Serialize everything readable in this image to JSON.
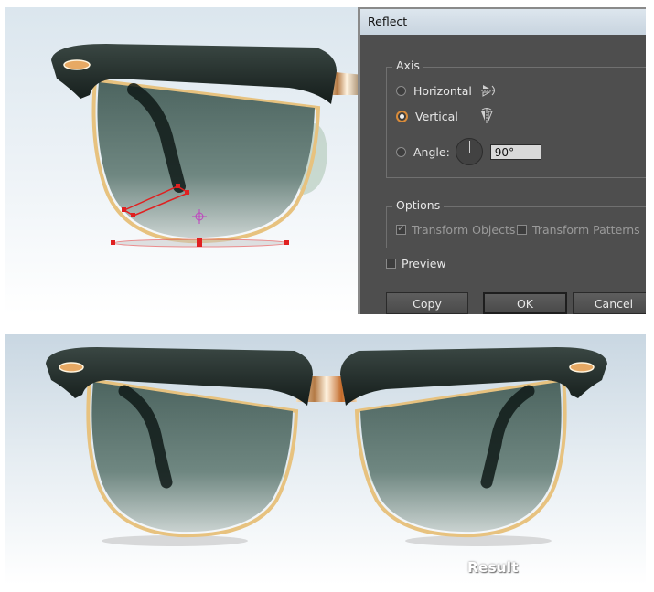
{
  "dialog": {
    "title": "Reflect",
    "axis": {
      "group_label": "Axis",
      "horizontal_label": "Horizontal",
      "vertical_label": "Vertical",
      "angle_label": "Angle:",
      "angle_value": "90°",
      "selected": "Vertical"
    },
    "options": {
      "group_label": "Options",
      "transform_objects_label": "Transform Objects",
      "transform_objects_checked": true,
      "transform_patterns_label": "Transform Patterns",
      "transform_patterns_checked": false
    },
    "preview_label": "Preview",
    "preview_checked": false,
    "buttons": {
      "copy": "Copy",
      "ok": "OK",
      "cancel": "Cancel"
    }
  },
  "result_label": "Result",
  "colors": {
    "frame": "#1f2a27",
    "lens": "#5f7770",
    "gold": "#e8c890",
    "accent_orange": "#d88b3a",
    "selection_red": "#e02020",
    "pivot_magenta": "#c040c0"
  }
}
